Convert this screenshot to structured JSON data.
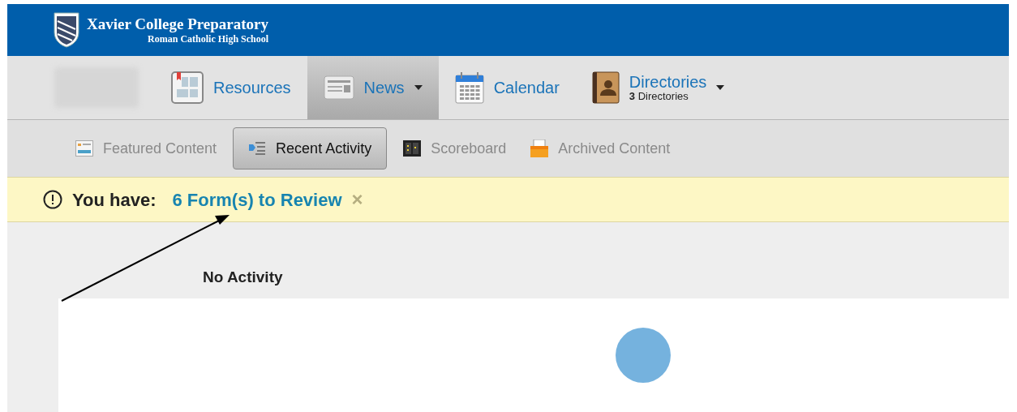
{
  "header": {
    "title": "Xavier College Preparatory",
    "subtitle": "Roman Catholic High School"
  },
  "nav": [
    {
      "kind": "resources",
      "label": "Resources",
      "selected": false,
      "dropdown": false
    },
    {
      "kind": "news",
      "label": "News",
      "selected": true,
      "dropdown": true
    },
    {
      "kind": "calendar",
      "label": "Calendar",
      "selected": false,
      "dropdown": false
    },
    {
      "kind": "directories",
      "label": "Directories",
      "count": "3",
      "sublabel": "Directories",
      "selected": false,
      "dropdown": true
    }
  ],
  "subnav": [
    {
      "kind": "featured",
      "label": "Featured Content",
      "selected": false
    },
    {
      "kind": "recent",
      "label": "Recent Activity",
      "selected": true
    },
    {
      "kind": "scoreboard",
      "label": "Scoreboard",
      "selected": false
    },
    {
      "kind": "archived",
      "label": "Archived Content",
      "selected": false
    }
  ],
  "alert": {
    "label": "You have:",
    "link": "6 Form(s) to Review",
    "close": "×"
  },
  "content": {
    "message": "No Activity"
  }
}
